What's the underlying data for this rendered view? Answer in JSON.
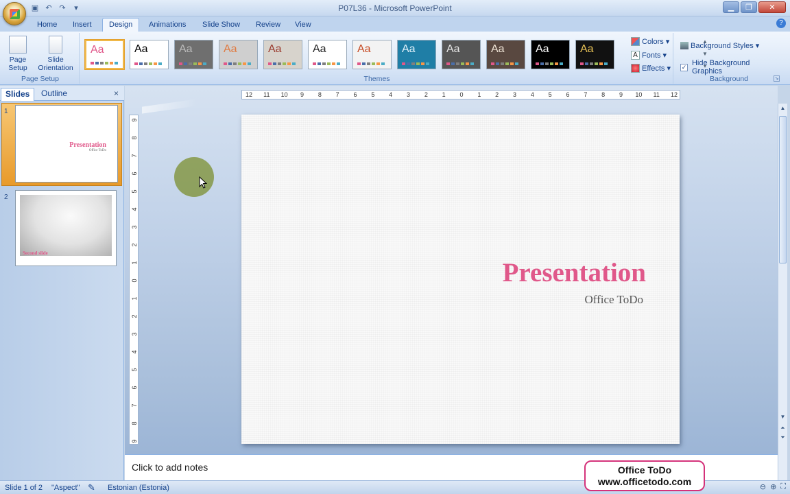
{
  "window": {
    "title": "P07L36 - Microsoft PowerPoint"
  },
  "tabs": [
    "Home",
    "Insert",
    "Design",
    "Animations",
    "Slide Show",
    "Review",
    "View"
  ],
  "active_tab": "Design",
  "ribbon": {
    "page_setup": {
      "page_setup_label": "Page Setup",
      "orientation_label": "Slide Orientation",
      "group_label": "Page Setup"
    },
    "themes": {
      "group_label": "Themes",
      "items": [
        {
          "aa": "Aa",
          "bg": "#ffffff",
          "fg": "#e0588a",
          "selected": true
        },
        {
          "aa": "Aa",
          "bg": "#ffffff",
          "fg": "#000000"
        },
        {
          "aa": "Aa",
          "bg": "#6f6f6f",
          "fg": "#bbbbbb"
        },
        {
          "aa": "Aa",
          "bg": "#cfcfcf",
          "fg": "#e07a40"
        },
        {
          "aa": "Aa",
          "bg": "#d7d3cc",
          "fg": "#9a3b2e"
        },
        {
          "aa": "Aa",
          "bg": "#ffffff",
          "fg": "#222222"
        },
        {
          "aa": "Aa",
          "bg": "#f3f3f3",
          "fg": "#c64a23"
        },
        {
          "aa": "Aa",
          "bg": "#1f7ea6",
          "fg": "#e4f3fb"
        },
        {
          "aa": "Aa",
          "bg": "#555555",
          "fg": "#e6e6e6"
        },
        {
          "aa": "Aa",
          "bg": "#594840",
          "fg": "#f1e6d8"
        },
        {
          "aa": "Aa",
          "bg": "#000000",
          "fg": "#ffffff"
        },
        {
          "aa": "Aa",
          "bg": "#111111",
          "fg": "#e8c256"
        }
      ]
    },
    "theme_options": {
      "colors": "Colors",
      "fonts": "Fonts",
      "effects": "Effects"
    },
    "background": {
      "styles_label": "Background Styles",
      "hide_label": "Hide Background Graphics",
      "hide_checked": true,
      "group_label": "Background"
    }
  },
  "left_pane": {
    "tabs": [
      "Slides",
      "Outline"
    ],
    "slides": [
      {
        "num": "1",
        "title": "Presentation",
        "subtitle": "Office ToDo"
      },
      {
        "num": "2",
        "title": "Second slide"
      }
    ]
  },
  "slide": {
    "title": "Presentation",
    "subtitle": "Office ToDo"
  },
  "notes": {
    "placeholder": "Click to add notes"
  },
  "watermark": {
    "line1": "Office ToDo",
    "line2": "www.officetodo.com"
  },
  "status": {
    "slide": "Slide 1 of 2",
    "theme": "\"Aspect\"",
    "language": "Estonian (Estonia)"
  },
  "rulers": {
    "h": [
      "12",
      "11",
      "10",
      "9",
      "8",
      "7",
      "6",
      "5",
      "4",
      "3",
      "2",
      "1",
      "0",
      "1",
      "2",
      "3",
      "4",
      "5",
      "6",
      "7",
      "8",
      "9",
      "10",
      "11",
      "12"
    ],
    "v": [
      "9",
      "8",
      "7",
      "6",
      "5",
      "4",
      "3",
      "2",
      "1",
      "0",
      "1",
      "2",
      "3",
      "4",
      "5",
      "6",
      "7",
      "8",
      "9"
    ]
  }
}
